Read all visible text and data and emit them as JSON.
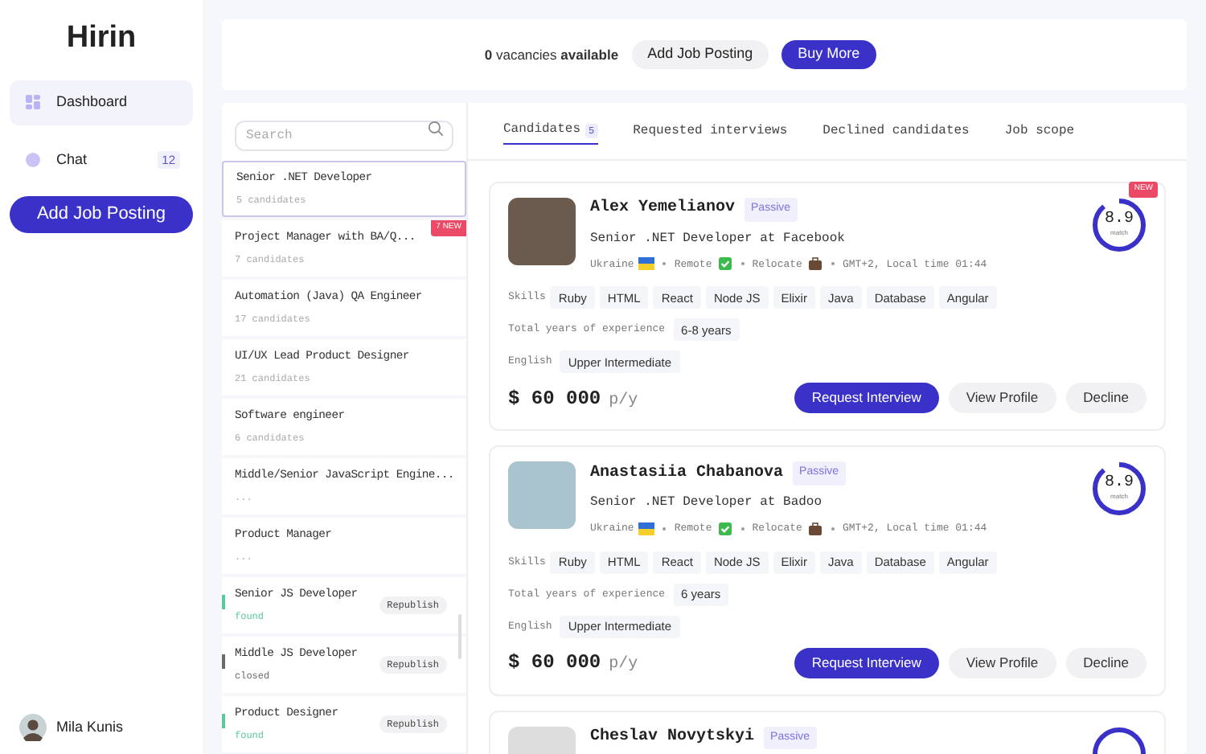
{
  "logo": "Hirin",
  "nav": [
    {
      "label": "Dashboard",
      "selected": true,
      "kind": "dashboard"
    },
    {
      "label": "Chat",
      "selected": false,
      "kind": "chat",
      "badge": "12"
    }
  ],
  "add_job_button": "Add Job Posting",
  "user": {
    "name": "Mila Kunis"
  },
  "top_bar": {
    "vacancies": "**0** vacancies **available**",
    "add_button": "Add Job Posting",
    "buy_button": "Buy More"
  },
  "search": {
    "placeholder": "Search"
  },
  "jobs": [
    {
      "title": "Senior .NET Developer",
      "subtitle": "5 candidates",
      "selected": true
    },
    {
      "title": "Project Manager with BA/Q...",
      "subtitle": "7 candidates",
      "selected": false,
      "badge": "7 NEW"
    },
    {
      "title": "Automation (Java) QA Engineer",
      "subtitle": "17 candidates",
      "selected": false
    },
    {
      "title": "UI/UX Lead Product Designer",
      "subtitle": "21 candidates",
      "selected": false
    },
    {
      "title": "Software engineer",
      "subtitle": "6 candidates",
      "selected": false
    },
    {
      "title": "Middle/Senior JavaScript Engine...",
      "subtitle": "...",
      "selected": false
    },
    {
      "title": "Product Manager",
      "subtitle": "...",
      "selected": false
    },
    {
      "title": "Senior JS Developer",
      "subtitle": "found",
      "selected": false,
      "color": "#5cc99a",
      "action": "Republish"
    },
    {
      "title": "Middle JS Developer",
      "subtitle": "closed",
      "selected": false,
      "color": "#6b6b6b",
      "action": "Republish"
    },
    {
      "title": "Product Designer",
      "subtitle": "found",
      "selected": false,
      "color": "#5cc99a",
      "action": "Republish"
    }
  ],
  "tabs": [
    {
      "label": "Candidates",
      "count": "5",
      "selected": true
    },
    {
      "label": "Requested interviews",
      "selected": false
    },
    {
      "label": "Declined candidates",
      "selected": false
    },
    {
      "label": "Job scope",
      "selected": false
    }
  ],
  "candidates": [
    {
      "name": "Alex Yemelianov",
      "tag": "Passive",
      "new_badge": "NEW",
      "title": "Senior .NET Developer at Facebook",
      "country": "Ukraine",
      "remote": "Remote",
      "relocate": "Relocate",
      "timezone": "GMT+2, Local time 01:44",
      "score": "8.9",
      "score_label": "match",
      "level": 0.89,
      "skills_label": "Skills",
      "skills": [
        "Ruby",
        "HTML",
        "React",
        "Node JS",
        "Elixir",
        "Java",
        "Database",
        "Angular"
      ],
      "experience_label": "Total years of experience",
      "experience": "6-8 years",
      "english_label": "English",
      "english": "Upper Intermediate",
      "salary": "$ 60 000",
      "salary_unit": "p/y",
      "buttons": [
        "Request Interview",
        "View Profile",
        "Decline"
      ]
    },
    {
      "name": "Anastasiia Chabanova",
      "tag": "Passive",
      "title": "Senior .NET Developer at Badoo",
      "country": "Ukraine",
      "remote": "Remote",
      "relocate": "Relocate",
      "timezone": "GMT+2, Local time 01:44",
      "score": "8.9",
      "score_label": "match",
      "level": 0.89,
      "skills_label": "Skills",
      "skills": [
        "Ruby",
        "HTML",
        "React",
        "Node JS",
        "Elixir",
        "Java",
        "Database",
        "Angular"
      ],
      "experience_label": "Total years of experience",
      "experience": "6 years",
      "english_label": "English",
      "english": "Upper Intermediate",
      "salary": "$ 60 000",
      "salary_unit": "p/y",
      "buttons": [
        "Request Interview",
        "View Profile",
        "Decline"
      ]
    },
    {
      "name": "Cheslav Novytskyi",
      "tag": "Passive"
    }
  ]
}
